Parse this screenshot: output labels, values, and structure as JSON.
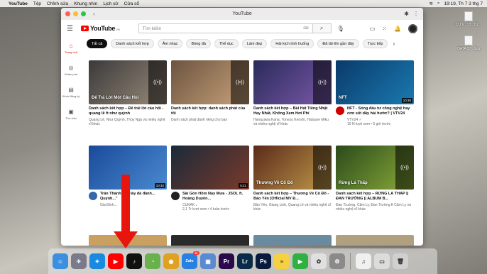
{
  "menubar": {
    "app": "YouTube",
    "items": [
      "Tệp",
      "Chỉnh sửa",
      "Khung nhìn",
      "Lịch sử",
      "Cửa sổ"
    ],
    "clock": "19:19, Th 7 3 thg 7"
  },
  "desktop": [
    {
      "label": "CU V...T3...D2..."
    },
    {
      "label": "DATA 27...0xg"
    }
  ],
  "browser": {
    "window_title": "YouTube"
  },
  "youtube": {
    "logo": "YouTube",
    "logo_region": "VN",
    "search_placeholder": "Tìm kiếm",
    "sidebar": [
      {
        "label": "Trang chủ",
        "icon": "home-icon",
        "active": true
      },
      {
        "label": "Khám phá",
        "icon": "compass-icon"
      },
      {
        "label": "Kênh đăng ký",
        "icon": "subscriptions-icon"
      },
      {
        "label": "Thư viện",
        "icon": "library-icon"
      }
    ],
    "chips": [
      "Tất cả",
      "Danh sách kết hợp",
      "Âm nhạc",
      "Bóng đá",
      "Thể dục",
      "Làm đẹp",
      "Hài kịch tình huống",
      "Đã tải lên gần đây",
      "Trực tiếp"
    ],
    "videos": [
      {
        "title": "Danh sách kết hợp – Để trái lời cầu hôi - quang lê ft như quỳnh",
        "channel": "Quang Lê, Như Quỳnh, Thủy Nga và nhiều nghệ sĩ khác",
        "stats": "",
        "thumb_text": "Để Trả Lời Một Câu Hỏi",
        "mix": true,
        "duration": "",
        "colors": [
          "#3a3a3a",
          "#9a8a7a"
        ],
        "avatar": ""
      },
      {
        "title": "Danh sách kết hợp: danh sách phát của tôi",
        "channel": "Danh sách phát dành riêng cho bạn",
        "stats": "",
        "thumb_text": "",
        "mix": true,
        "duration": "",
        "colors": [
          "#6b5440",
          "#c9a27a"
        ],
        "avatar": ""
      },
      {
        "title": "Danh sách kết hợp – Bài Hát Tiếng Nhật Hay Nhất, Không Xem Hơi Phí",
        "channel": "Hanazawa Kana, Yonezu Kenshi, Hatsune Miku và nhiều nghệ sĩ khác",
        "stats": "",
        "thumb_text": "",
        "mix": true,
        "duration": "",
        "colors": [
          "#2a2a5a",
          "#7a5aaa"
        ],
        "avatar": ""
      },
      {
        "title": "NFT - Sóng đầu tư công nghệ hay cơn sốt dây hài hước? | VTV24",
        "channel": "VTV24 ✓",
        "stats": "10 N lượt xem • 5 giờ trước",
        "thumb_text": "NFT",
        "mix": false,
        "duration": "10:30",
        "colors": [
          "#0a3a6a",
          "#1a7ab0"
        ],
        "avatar": "#c00"
      },
      {
        "title": "Trấn Thành: \"Ai lấy đá đánh... Quỳnh...\"",
        "channel": "Gia Đình...",
        "stats": "",
        "thumb_text": "",
        "mix": false,
        "duration": "10:32",
        "colors": [
          "#1a4a9a",
          "#4a8ad0"
        ],
        "avatar": "#36a"
      },
      {
        "title": "Sài Gòn Hôm Nay Mưa - JSOL ft. Hoàng Duyên...",
        "channel": "CUKAK ♪",
        "stats": "2,1 Tr lượt xem • 4 tuần trước",
        "thumb_text": "",
        "mix": false,
        "duration": "5:21",
        "colors": [
          "#1a2a3a",
          "#7a3a2a"
        ],
        "avatar": "#222"
      },
      {
        "title": "Danh sách kết hợp – Thương Về Cố Đô - Bảo Yến [Official MV Đ...",
        "channel": "Bảo Yến, Giang Linh, Quang Lê và nhiều nghệ sĩ khác",
        "stats": "",
        "thumb_text": "Thương Về Cố Đô",
        "mix": true,
        "duration": "",
        "colors": [
          "#5a2a1a",
          "#c09a4a"
        ],
        "avatar": ""
      },
      {
        "title": "Danh sách kết hợp – RỪNG LÁ THẤP || ĐAN TRƯỜNG || ALBUM B...",
        "channel": "Đan Trường, Cẩm Ly, Đan Trường ft Cẩm Ly và nhiều nghệ sĩ khác",
        "stats": "",
        "thumb_text": "Rừng Lá Thấp",
        "mix": true,
        "duration": "",
        "colors": [
          "#2a4a1a",
          "#8aaa3a"
        ],
        "avatar": ""
      }
    ]
  },
  "dock": [
    {
      "name": "finder-icon",
      "color": "#3b8fe0",
      "glyph": "☺"
    },
    {
      "name": "launchpad-icon",
      "color": "#7a7a8a",
      "glyph": "✈"
    },
    {
      "name": "safari-icon",
      "color": "#1a8ae0",
      "glyph": "✦"
    },
    {
      "name": "youtube-app-icon",
      "color": "#ff0000",
      "glyph": "▶"
    },
    {
      "name": "tiktok-icon",
      "color": "#111111",
      "glyph": "♪"
    },
    {
      "name": "coccoc-icon",
      "color": "#6ab04c",
      "glyph": "◔"
    },
    {
      "name": "chrome-icon",
      "color": "#e0a020",
      "glyph": "◉"
    },
    {
      "name": "zalo-icon",
      "color": "#2a80e0",
      "glyph": "Zalo",
      "badge": "8+"
    },
    {
      "name": "preview-icon",
      "color": "#5a8ad0",
      "glyph": "▣"
    },
    {
      "name": "premiere-icon",
      "color": "#2a0a4a",
      "glyph": "Pr"
    },
    {
      "name": "lightroom-icon",
      "color": "#0a2a4a",
      "glyph": "Lr"
    },
    {
      "name": "photoshop-icon",
      "color": "#0a1a3a",
      "glyph": "Ps"
    },
    {
      "name": "notes-icon",
      "color": "#f5d040",
      "glyph": "≡"
    },
    {
      "name": "facetime-icon",
      "color": "#30b040",
      "glyph": "▶"
    },
    {
      "name": "photos-icon",
      "color": "#e0e0e0",
      "glyph": "✿"
    },
    {
      "name": "system-prefs-icon",
      "color": "#8a8a8a",
      "glyph": "⚙"
    },
    {
      "name": "music-file-icon",
      "color": "#f0f0f0",
      "glyph": "♫"
    },
    {
      "name": "screenshot-file-icon",
      "color": "#dcdcdc",
      "glyph": "▭"
    },
    {
      "name": "trash-icon",
      "color": "#d0d0d0",
      "glyph": "🗑"
    }
  ]
}
